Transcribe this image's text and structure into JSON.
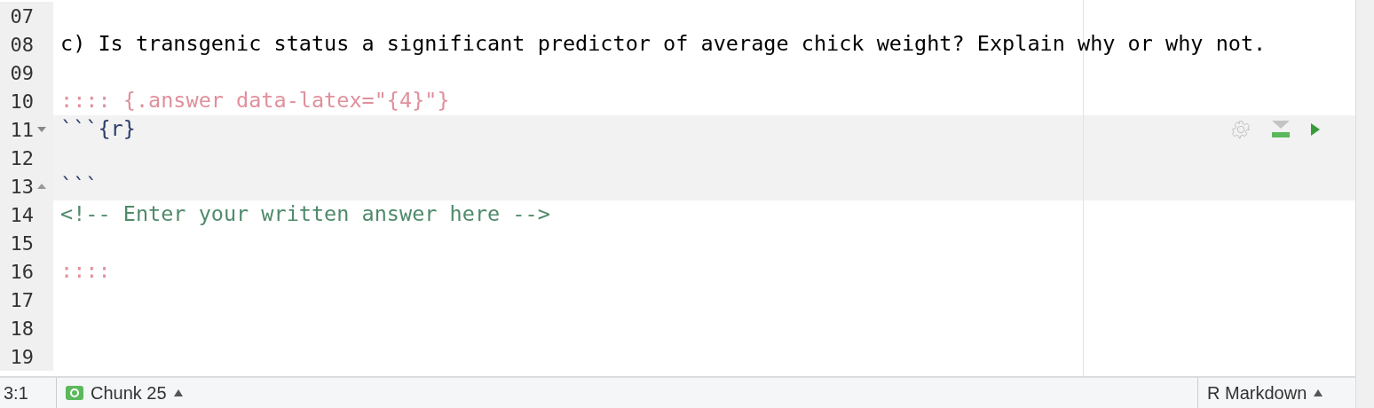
{
  "lines": [
    {
      "number": "07",
      "kind": "blank"
    },
    {
      "number": "08",
      "kind": "prose",
      "text": "c) Is transgenic status a significant predictor of average chick weight? Explain why or why not."
    },
    {
      "number": "09",
      "kind": "blank"
    },
    {
      "number": "10",
      "kind": "div",
      "text": ":::: {.answer data-latex=\"{4}\"}"
    },
    {
      "number": "11",
      "kind": "chunk-start",
      "text": "```{r}"
    },
    {
      "number": "12",
      "kind": "chunk"
    },
    {
      "number": "13",
      "kind": "chunk-end",
      "text": "```"
    },
    {
      "number": "14",
      "kind": "comment",
      "text": "<!-- Enter your written answer here -->"
    },
    {
      "number": "15",
      "kind": "blank"
    },
    {
      "number": "16",
      "kind": "div",
      "text": "::::"
    },
    {
      "number": "17",
      "kind": "blank"
    },
    {
      "number": "18",
      "kind": "blank"
    },
    {
      "number": "19",
      "kind": "blank"
    }
  ],
  "status_bar": {
    "position": "3:1",
    "chunk": "Chunk 25",
    "mode": "R Markdown"
  }
}
